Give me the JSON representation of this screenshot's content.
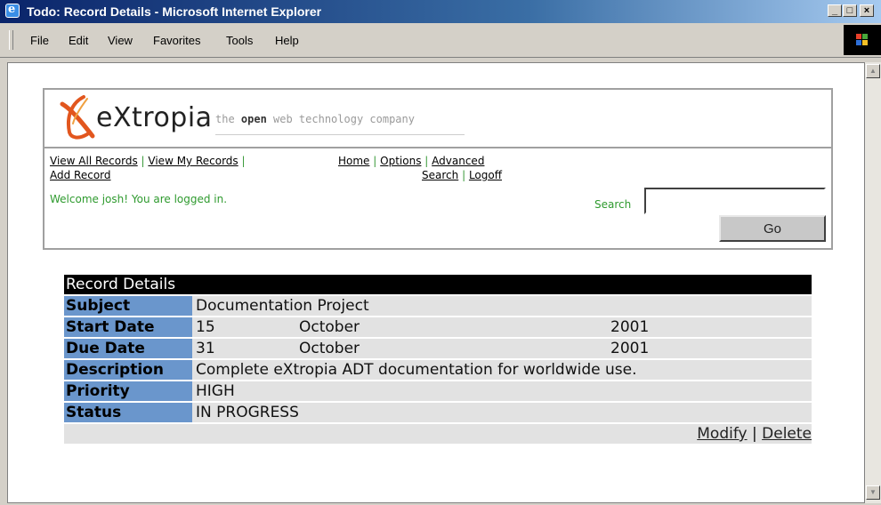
{
  "window": {
    "title": "Todo: Record Details - Microsoft Internet Explorer",
    "icon": "ie-icon",
    "controls": [
      "minimize",
      "maximize",
      "close"
    ]
  },
  "menu": {
    "items": [
      {
        "label": "File",
        "key": "F"
      },
      {
        "label": "Edit",
        "key": "E"
      },
      {
        "label": "View",
        "key": "V"
      },
      {
        "label": "Favorites",
        "key": "a"
      },
      {
        "label": "Tools",
        "key": "T"
      },
      {
        "label": "Help",
        "key": "H"
      }
    ]
  },
  "header": {
    "logo_text": "eXtropia",
    "tagline_pre": "the ",
    "tagline_bold": "open",
    "tagline_post": " web technology company"
  },
  "nav": {
    "left": [
      "View All Records",
      "View My Records",
      "Add Record"
    ],
    "right": [
      "Home",
      "Options",
      "Advanced Search",
      "Logoff"
    ],
    "right_line1": [
      "Home",
      "Options",
      "Advanced"
    ],
    "right_line2": [
      "Search",
      "Logoff"
    ],
    "separator": "|"
  },
  "welcome": "Welcome josh! You are logged in.",
  "search": {
    "label": "Search",
    "value": "",
    "button": "Go"
  },
  "record": {
    "heading": "Record Details",
    "fields": {
      "subject": {
        "label": "Subject",
        "value": "Documentation Project"
      },
      "start_date": {
        "label": "Start Date",
        "day": "15",
        "month": "October",
        "year": "2001"
      },
      "due_date": {
        "label": "Due Date",
        "day": "31",
        "month": "October",
        "year": "2001"
      },
      "description": {
        "label": "Description",
        "value": "Complete eXtropia ADT documentation for worldwide use."
      },
      "priority": {
        "label": "Priority",
        "value": "HIGH"
      },
      "status": {
        "label": "Status",
        "value": "IN PROGRESS"
      }
    },
    "actions": {
      "modify": "Modify",
      "separator": "|",
      "delete": "Delete"
    }
  },
  "colors": {
    "title_bar": "#0a246a",
    "label_bg": "#6a96cc",
    "row_bg": "#e2e2e2",
    "green_text": "#2e9a2e",
    "logo_accent": "#e2561e"
  }
}
